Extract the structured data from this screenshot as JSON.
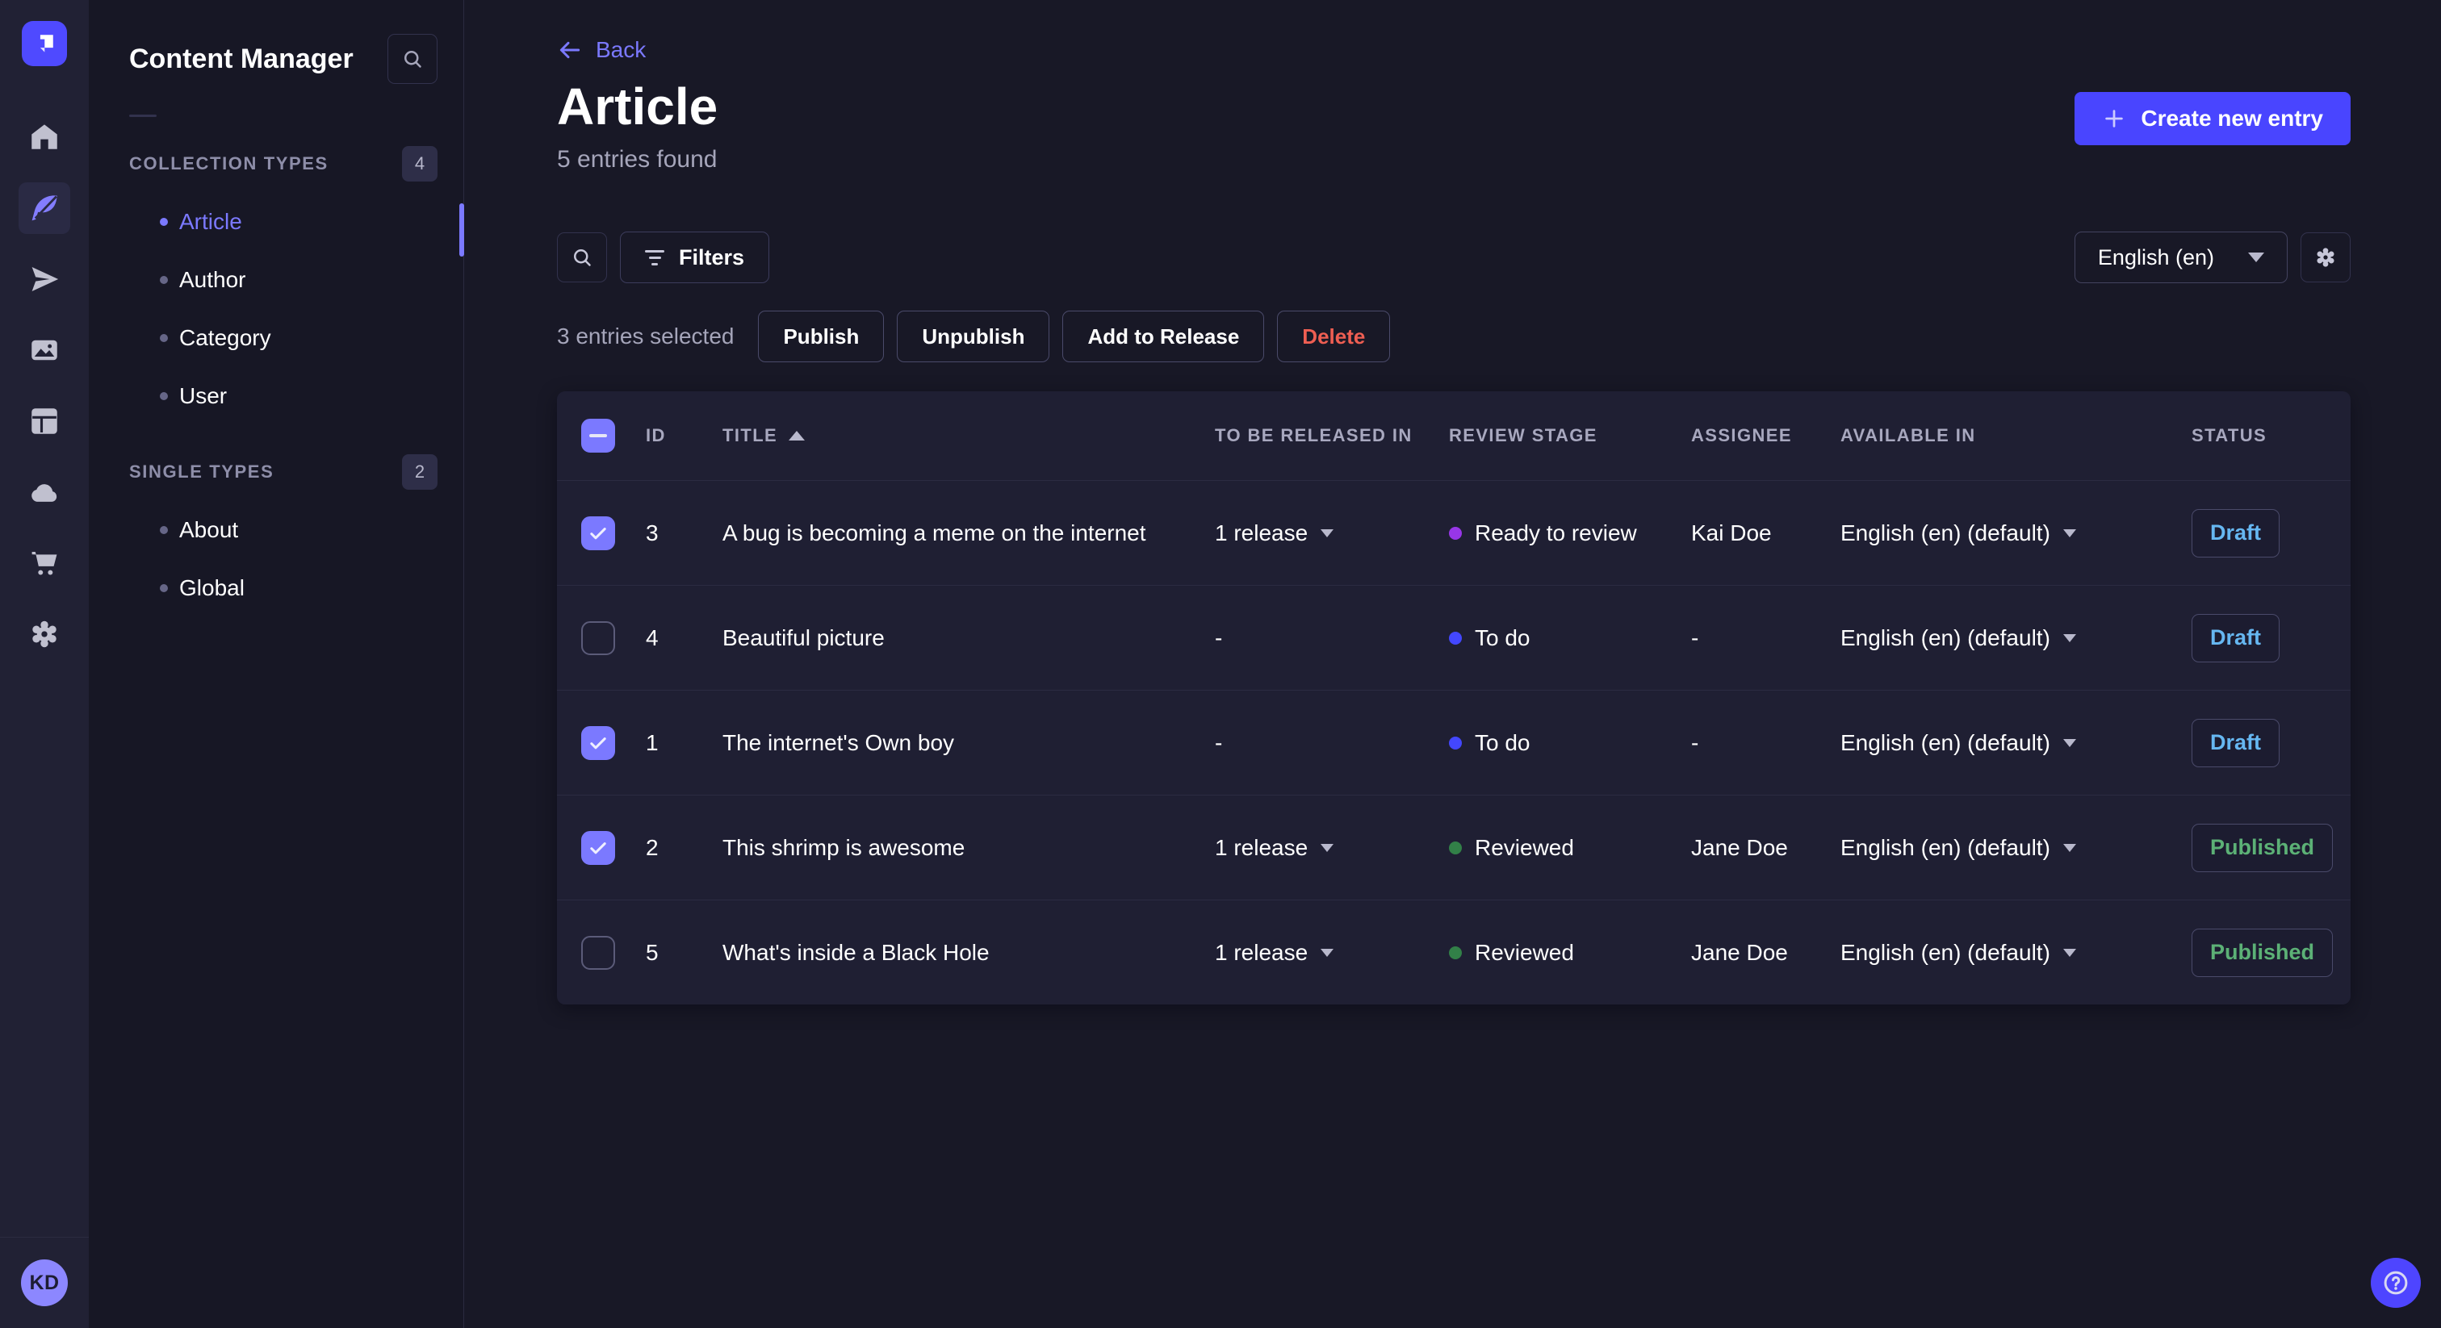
{
  "app": {
    "rail_icons": [
      "home",
      "content-manager",
      "releases",
      "media-library",
      "content-type-builder",
      "deploy",
      "marketplace",
      "settings"
    ],
    "user_initials": "KD"
  },
  "subnav": {
    "title": "Content Manager",
    "collection_types": {
      "label": "COLLECTION TYPES",
      "count": "4",
      "items": [
        {
          "label": "Article",
          "active": true
        },
        {
          "label": "Author",
          "active": false
        },
        {
          "label": "Category",
          "active": false
        },
        {
          "label": "User",
          "active": false
        }
      ]
    },
    "single_types": {
      "label": "SINGLE TYPES",
      "count": "2",
      "items": [
        {
          "label": "About",
          "active": false
        },
        {
          "label": "Global",
          "active": false
        }
      ]
    }
  },
  "header": {
    "back_label": "Back",
    "title": "Article",
    "subtitle": "5 entries found",
    "create_button_label": "Create new entry"
  },
  "toolbar": {
    "filters_label": "Filters",
    "locale_selected": "English (en)"
  },
  "selection": {
    "text": "3 entries selected",
    "publish_label": "Publish",
    "unpublish_label": "Unpublish",
    "add_to_release_label": "Add to Release",
    "delete_label": "Delete"
  },
  "table": {
    "select_all_state": "indeterminate",
    "headers": {
      "id": "ID",
      "title": "TITLE",
      "release": "TO BE RELEASED IN",
      "review_stage": "REVIEW STAGE",
      "assignee": "ASSIGNEE",
      "available_in": "AVAILABLE IN",
      "status": "STATUS"
    },
    "rows": [
      {
        "selected": true,
        "id": "3",
        "title": "A bug is becoming a meme on the internet",
        "release": "1 release",
        "has_release": true,
        "stage": "Ready to review",
        "stage_color": "#9736e8",
        "assignee": "Kai Doe",
        "locale": "English (en) (default)",
        "status": "Draft",
        "status_variant": "draft"
      },
      {
        "selected": false,
        "id": "4",
        "title": "Beautiful picture",
        "release": "-",
        "has_release": false,
        "stage": "To do",
        "stage_color": "#4347ff",
        "assignee": "-",
        "locale": "English (en) (default)",
        "status": "Draft",
        "status_variant": "draft"
      },
      {
        "selected": true,
        "id": "1",
        "title": "The internet's Own boy",
        "release": "-",
        "has_release": false,
        "stage": "To do",
        "stage_color": "#4347ff",
        "assignee": "-",
        "locale": "English (en) (default)",
        "status": "Draft",
        "status_variant": "draft"
      },
      {
        "selected": true,
        "id": "2",
        "title": "This shrimp is awesome",
        "release": "1 release",
        "has_release": true,
        "stage": "Reviewed",
        "stage_color": "#328048",
        "assignee": "Jane Doe",
        "locale": "English (en) (default)",
        "status": "Published",
        "status_variant": "published"
      },
      {
        "selected": false,
        "id": "5",
        "title": "What's inside a Black Hole",
        "release": "1 release",
        "has_release": true,
        "stage": "Reviewed",
        "stage_color": "#328048",
        "assignee": "Jane Doe",
        "locale": "English (en) (default)",
        "status": "Published",
        "status_variant": "published"
      }
    ]
  },
  "colors": {
    "accent": "#7b79ff",
    "primary": "#4945ff",
    "danger": "#ee5e52",
    "draft_text": "#66b7f1",
    "published_text": "#5cb176"
  }
}
